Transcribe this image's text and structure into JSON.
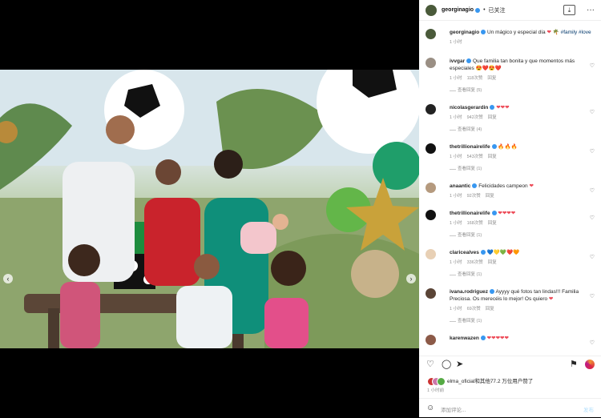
{
  "post": {
    "username": "georginagio",
    "follow_label": "已关注",
    "caption": "Un mágico y especial día",
    "caption_hashtags": [
      "#family",
      "#love"
    ],
    "caption_time": "1 小时",
    "likes_text": "elma_oficial和其他77.2 万位用户赞了",
    "time": "1 小时前",
    "comment_placeholder": "添加评论...",
    "post_button": "发布"
  },
  "comments": [
    {
      "user": "ivvgar",
      "text": "Que familia tan bonita y que momentos más especiales",
      "emoji": "😍❤️😍❤️",
      "time": "1 小时",
      "likes": "118次赞",
      "reply": "回复",
      "view": "查看回复 (5)"
    },
    {
      "user": "nicolasgerardin",
      "text": "",
      "emoji": "❤❤❤",
      "time": "1 小时",
      "likes": "942次赞",
      "reply": "回复",
      "view": "查看回复 (4)"
    },
    {
      "user": "thetrillionairelife",
      "text": "",
      "emoji": "🔥🔥🔥",
      "time": "1 小时",
      "likes": "543次赞",
      "reply": "回复",
      "view": "查看回复 (1)"
    },
    {
      "user": "anaantic",
      "text": "Felicidades campeon",
      "emoji": "❤",
      "time": "1 小时",
      "likes": "92次赞",
      "reply": "回复",
      "view": ""
    },
    {
      "user": "thetrillionairelife",
      "text": "",
      "emoji": "❤❤❤❤",
      "time": "1 小时",
      "likes": "168次赞",
      "reply": "回复",
      "view": "查看回复 (1)"
    },
    {
      "user": "claricealves",
      "text": "",
      "emoji": "💙💛💚❤️🧡",
      "time": "1 小时",
      "likes": "336次赞",
      "reply": "回复",
      "view": "查看回复 (1)"
    },
    {
      "user": "ivana.rodriguez",
      "text": "Ayyyy qué fotos tan lindas!!! Familia Preciosa. Os merecéis lo mejor! Os quiero",
      "emoji": "❤",
      "time": "1 小时",
      "likes": "69次赞",
      "reply": "回复",
      "view": "查看回复 (1)"
    },
    {
      "user": "karenwazen",
      "text": "",
      "emoji": "❤❤❤❤❤",
      "time": "",
      "likes": "",
      "reply": "",
      "view": ""
    }
  ],
  "colors": {
    "accent": "#3897f0",
    "heart": "#ed4956"
  }
}
